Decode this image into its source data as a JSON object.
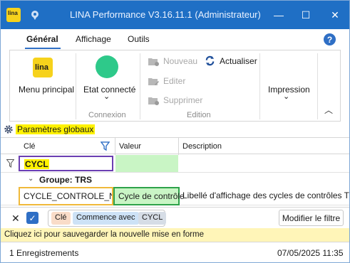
{
  "window": {
    "title": "LINA Performance  V3.16.11.1  (Administrateur)",
    "app_icon_text": "lina",
    "minimize": "—",
    "maximize": "☐",
    "close": "✕"
  },
  "tabs": [
    {
      "label": "Général",
      "active": true
    },
    {
      "label": "Affichage",
      "active": false
    },
    {
      "label": "Outils",
      "active": false
    }
  ],
  "help_label": "?",
  "ribbon": {
    "menu_principal": {
      "logo_text": "lina",
      "label": "Menu principal"
    },
    "connexion": {
      "label": "Etat connecté",
      "chevron": "⌄",
      "group_label": "Connexion",
      "status_color": "#2ec98a"
    },
    "edition": {
      "nouveau": "Nouveau",
      "editer": "Editer",
      "supprimer": "Supprimer",
      "actualiser": "Actualiser",
      "group_label": "Edition"
    },
    "impression": {
      "label": "Impression",
      "chevron": "⌄"
    },
    "collapse": "︿"
  },
  "section": {
    "title": "Paramètres globaux"
  },
  "grid": {
    "columns": [
      "Clé",
      "Valeur",
      "Description"
    ],
    "filter_value": "CYCL",
    "group_title": "Groupe: TRS",
    "rows": [
      {
        "key": "CYCLE_CONTROLE_NOM",
        "value": "Cycle de contrôle",
        "description": "Libellé d'affichage des cycles de contrôles TRS"
      }
    ]
  },
  "filter_bar": {
    "clear": "✕",
    "check": "✓",
    "chips": [
      "Clé",
      "Commence avec",
      "CYCL"
    ],
    "modify_button": "Modifier le filtre"
  },
  "save_bar": {
    "text": "Cliquez ici pour sauvegarder la nouvelle mise en forme"
  },
  "status_bar": {
    "records": "1 Enregistrements",
    "datetime": "07/05/2025 11:35"
  },
  "colors": {
    "titlebar": "#1f6fc5",
    "accent": "#2f6fc5",
    "highlight_yellow": "#fff200",
    "value_green": "#c9f5c5",
    "purple_border": "#6b3fb2",
    "orange_border": "#f0b93a",
    "green_border": "#2ea24a"
  }
}
